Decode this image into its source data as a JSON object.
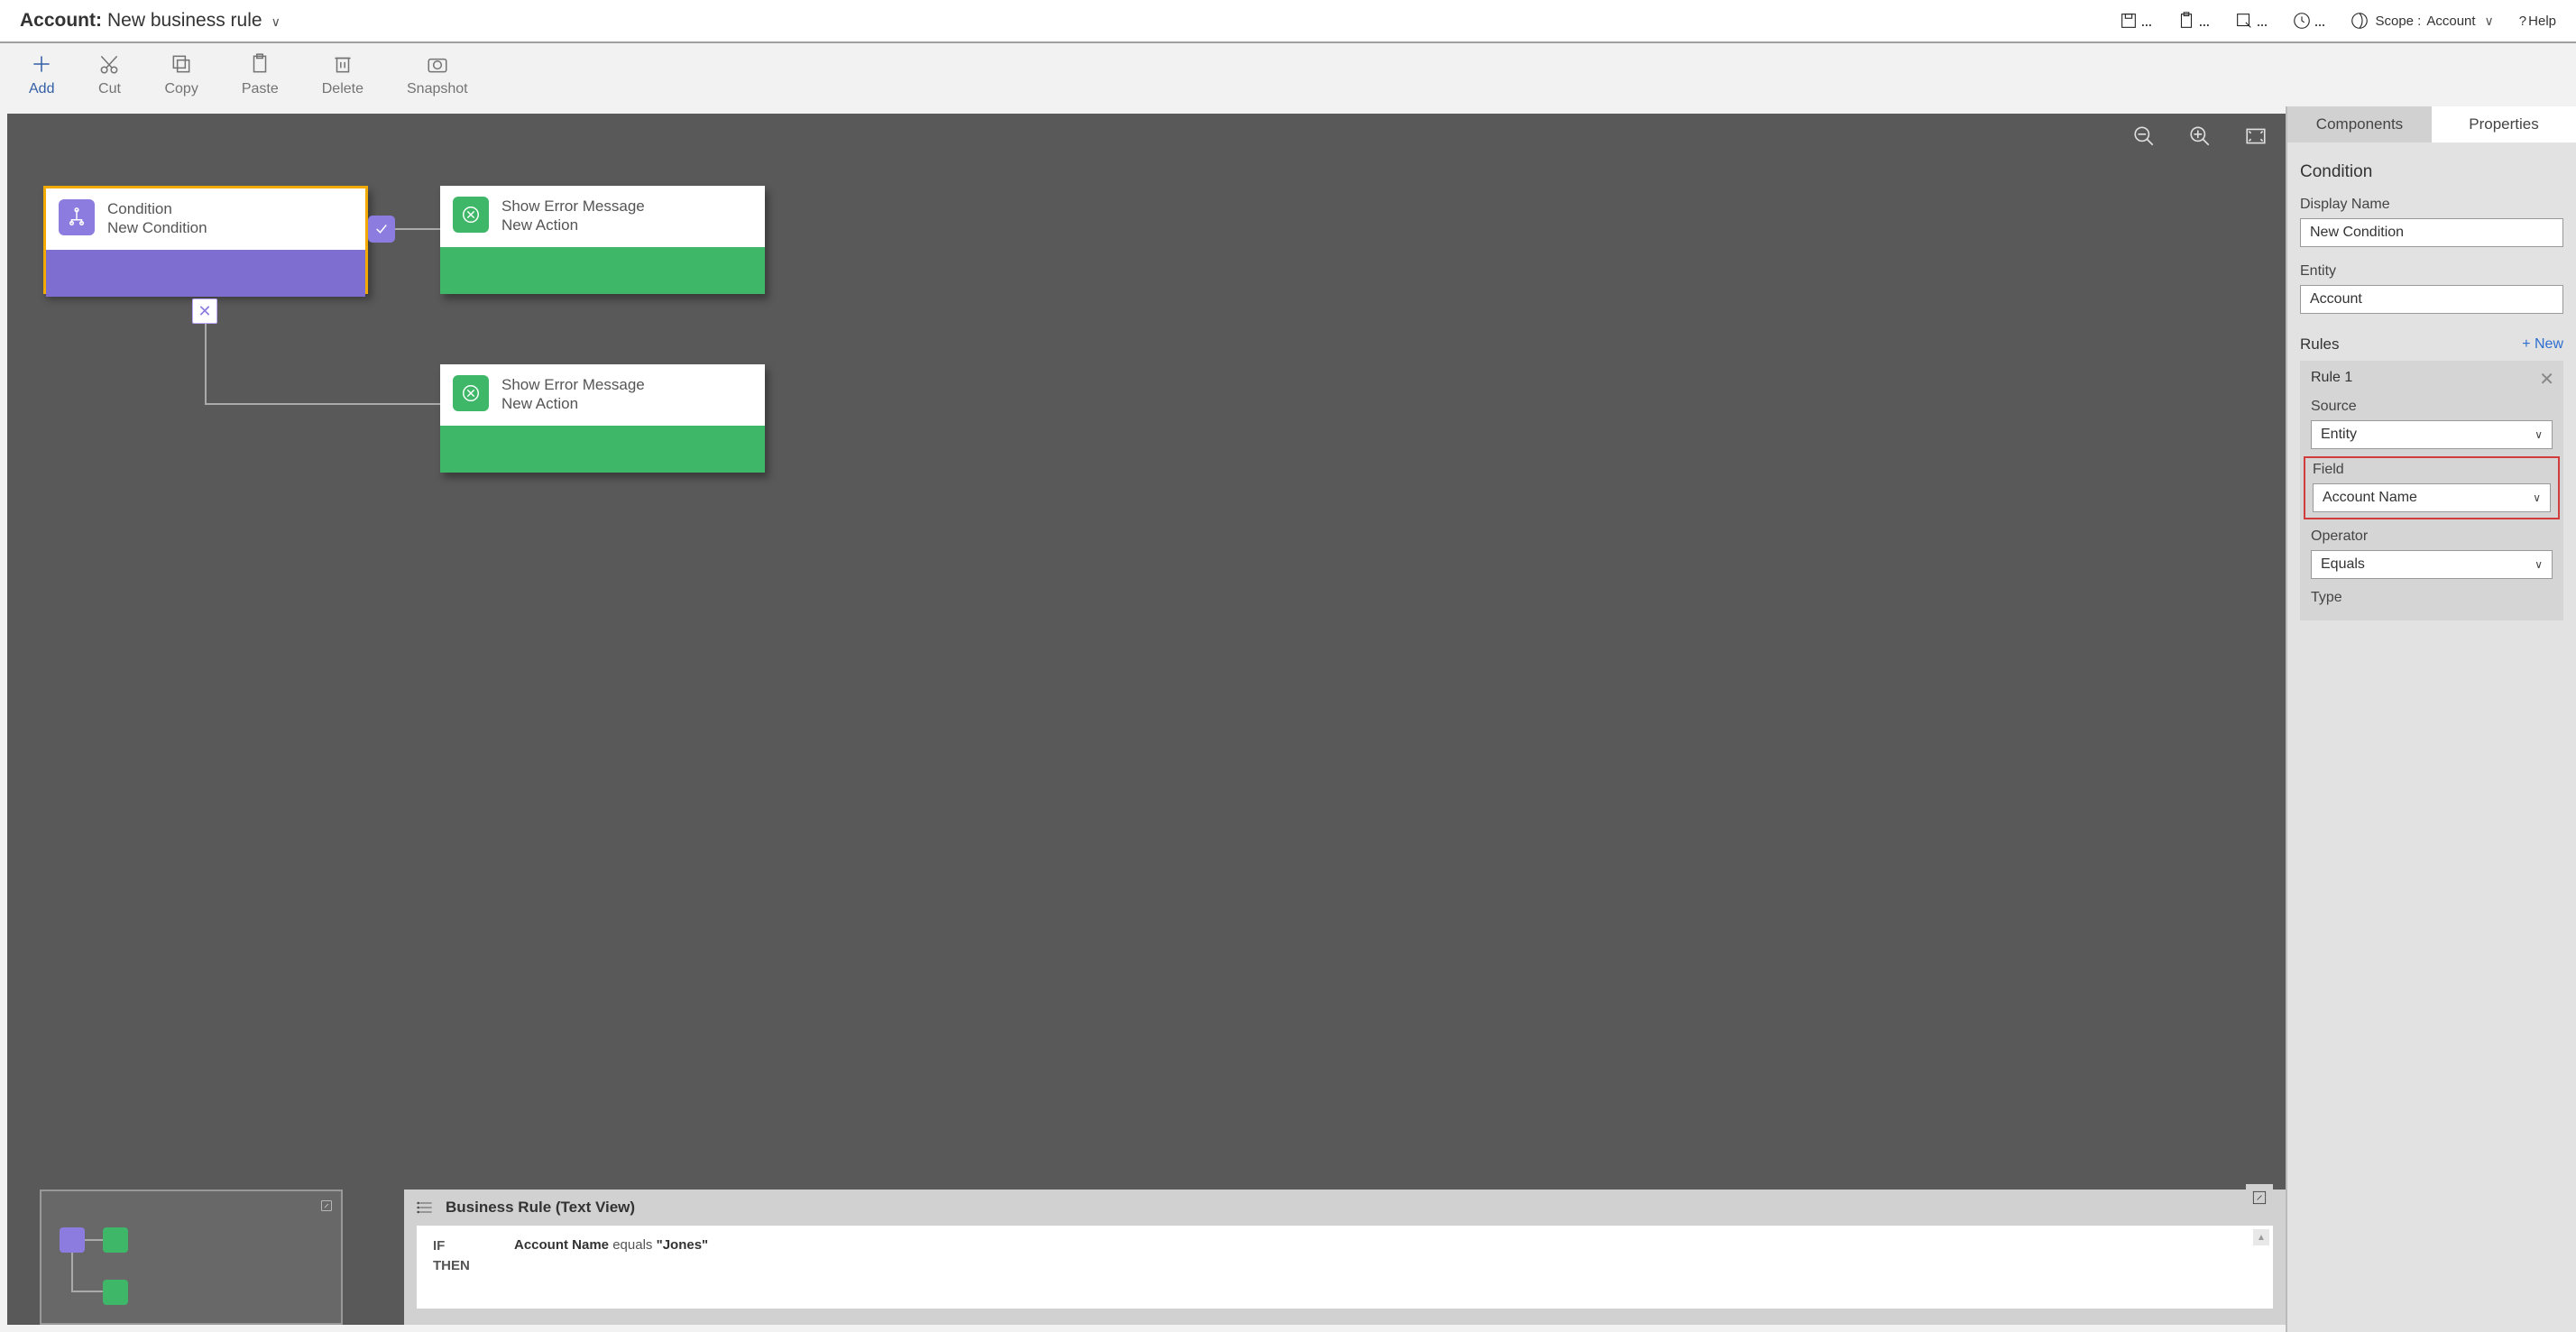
{
  "header": {
    "entity_label": "Account:",
    "rule_name": "New business rule",
    "scope_label": "Scope :",
    "scope_value": "Account",
    "help_label": "Help"
  },
  "toolbar": {
    "add": "Add",
    "cut": "Cut",
    "copy": "Copy",
    "paste": "Paste",
    "delete": "Delete",
    "snapshot": "Snapshot"
  },
  "canvas": {
    "condition_node": {
      "title": "Condition",
      "subtitle": "New Condition"
    },
    "action_node1": {
      "title": "Show Error Message",
      "subtitle": "New Action"
    },
    "action_node2": {
      "title": "Show Error Message",
      "subtitle": "New Action"
    }
  },
  "textview": {
    "title": "Business Rule (Text View)",
    "if": "IF",
    "then": "THEN",
    "field": "Account Name",
    "op": " equals ",
    "val": "\"Jones\""
  },
  "props": {
    "tab_components": "Components",
    "tab_properties": "Properties",
    "section_title": "Condition",
    "display_name_label": "Display Name",
    "display_name_value": "New Condition",
    "entity_label": "Entity",
    "entity_value": "Account",
    "rules_label": "Rules",
    "new_label": "+  New",
    "rule1_title": "Rule 1",
    "source_label": "Source",
    "source_value": "Entity",
    "field_label": "Field",
    "field_value": "Account Name",
    "operator_label": "Operator",
    "operator_value": "Equals",
    "type_label": "Type"
  }
}
